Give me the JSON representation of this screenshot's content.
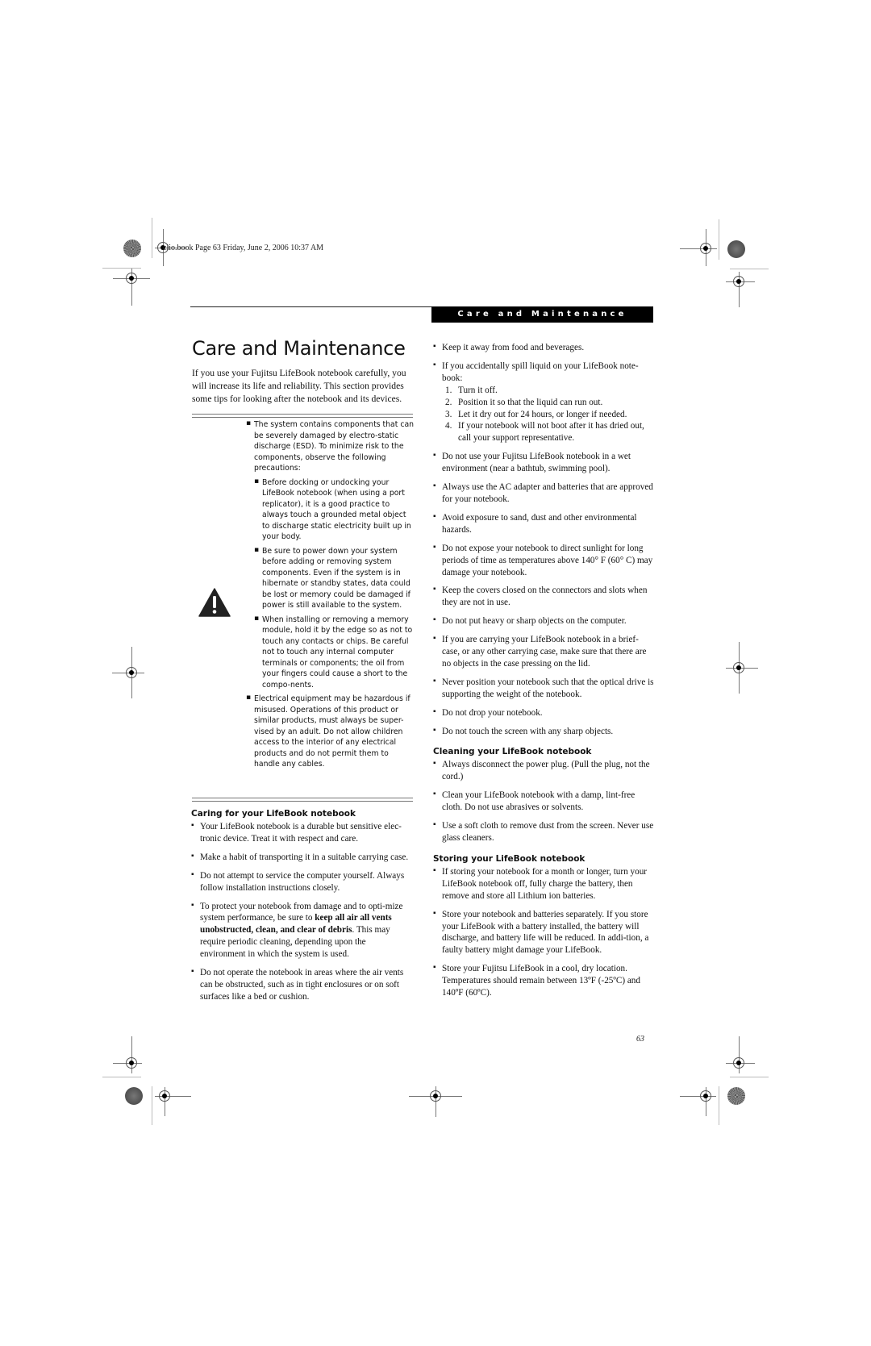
{
  "slug": "clio.book  Page 63  Friday, June 2, 2006  10:37 AM",
  "header": {
    "section_label": "Care and Maintenance"
  },
  "title": "Care and Maintenance",
  "intro": "If you use your Fujitsu LifeBook notebook carefully, you will increase its life and reliability. This section provides some tips for looking after the notebook and its devices.",
  "warning": {
    "icon": "warning-triangle-icon",
    "items": [
      {
        "text": "The system contains components that can be severely damaged by electro-static discharge (ESD). To minimize risk to the components, observe the following precautions:",
        "sub": [
          "Before docking or undocking your LifeBook notebook (when using a port replicator), it is a good practice to always touch a grounded metal object to discharge static electricity built up in your body.",
          "Be sure to power down your system before adding or removing system components. Even if the system is in hibernate or standby states, data could be lost or memory could be damaged if power is still available to the system.",
          "When installing or removing a memory module, hold it by the edge so as not to touch any contacts or chips. Be careful not to touch any internal computer terminals or components; the oil from your fingers could cause a short to the compo-nents."
        ]
      },
      {
        "text": "Electrical equipment may be hazardous if misused. Operations of this product or similar products, must always be super-vised by an adult. Do not allow children access to the interior of any electrical products and do not permit them to handle any cables."
      }
    ]
  },
  "caring": {
    "heading": "Caring for your LifeBook notebook",
    "items": [
      "Your LifeBook notebook is a durable but sensitive elec-tronic device. Treat it with respect and care.",
      "Make a habit of transporting it in a suitable carrying case.",
      "Do not attempt to service the computer yourself. Always follow installation instructions closely.",
      {
        "before": "To protect your notebook from damage and to opti-mize system performance, be sure to ",
        "bold": "keep all air all vents unobstructed, clean, and clear of debris",
        "after": ". This may require periodic cleaning, depending upon the environment in which the system is used."
      },
      "Do not operate the notebook in areas where the air vents can be obstructed, such as in tight enclosures or on soft surfaces like a bed or cushion."
    ]
  },
  "right": {
    "items_top": [
      "Keep it away from food and beverages.",
      "If you accidentally spill liquid on your LifeBook note-book:"
    ],
    "spill_steps": [
      {
        "n": "1.",
        "text": "Turn it off."
      },
      {
        "n": "2.",
        "text": "Position it so that the liquid can run out."
      },
      {
        "n": "3.",
        "text": "Let it dry out for 24 hours, or longer if needed."
      },
      {
        "n": "4.",
        "text": "If your notebook will not boot after it has dried out, call your support representative."
      }
    ],
    "items_rest": [
      "Do not use your Fujitsu LifeBook notebook in a wet environment (near a bathtub, swimming pool).",
      "Always use the AC adapter and batteries that are approved for your notebook.",
      "Avoid exposure to sand, dust and other environmental hazards.",
      "Do not expose your notebook to direct sunlight for long periods of time as temperatures above 140° F (60° C) may damage your notebook.",
      "Keep the covers closed on the connectors and slots when they are not in use.",
      "Do not put heavy or sharp objects on the computer.",
      "If you are carrying your LifeBook notebook in a brief-case, or any other carrying case, make sure that there are no objects in the case pressing on the lid.",
      "Never position your notebook such that the optical drive is supporting the weight of the notebook.",
      "Do not drop your notebook.",
      "Do not touch the screen with any sharp objects."
    ]
  },
  "cleaning": {
    "heading": "Cleaning your LifeBook notebook",
    "items": [
      "Always disconnect the power plug. (Pull the plug, not the cord.)",
      "Clean your LifeBook notebook with a damp, lint-free cloth. Do not use abrasives or solvents.",
      "Use a soft cloth to remove dust from the screen. Never use glass cleaners."
    ]
  },
  "storing": {
    "heading": "Storing your LifeBook notebook",
    "items": [
      "If storing your notebook for a month or longer, turn your LifeBook notebook off, fully charge the battery, then remove and store all Lithium ion batteries.",
      "Store your notebook and batteries separately. If you store your LifeBook with a battery installed, the battery will discharge, and battery life will be reduced. In addi-tion, a faulty battery might damage your LifeBook.",
      "Store your Fujitsu LifeBook in a cool, dry location. Temperatures should remain between 13ºF (-25ºC) and 140ºF (60ºC)."
    ]
  },
  "page_number": "63"
}
